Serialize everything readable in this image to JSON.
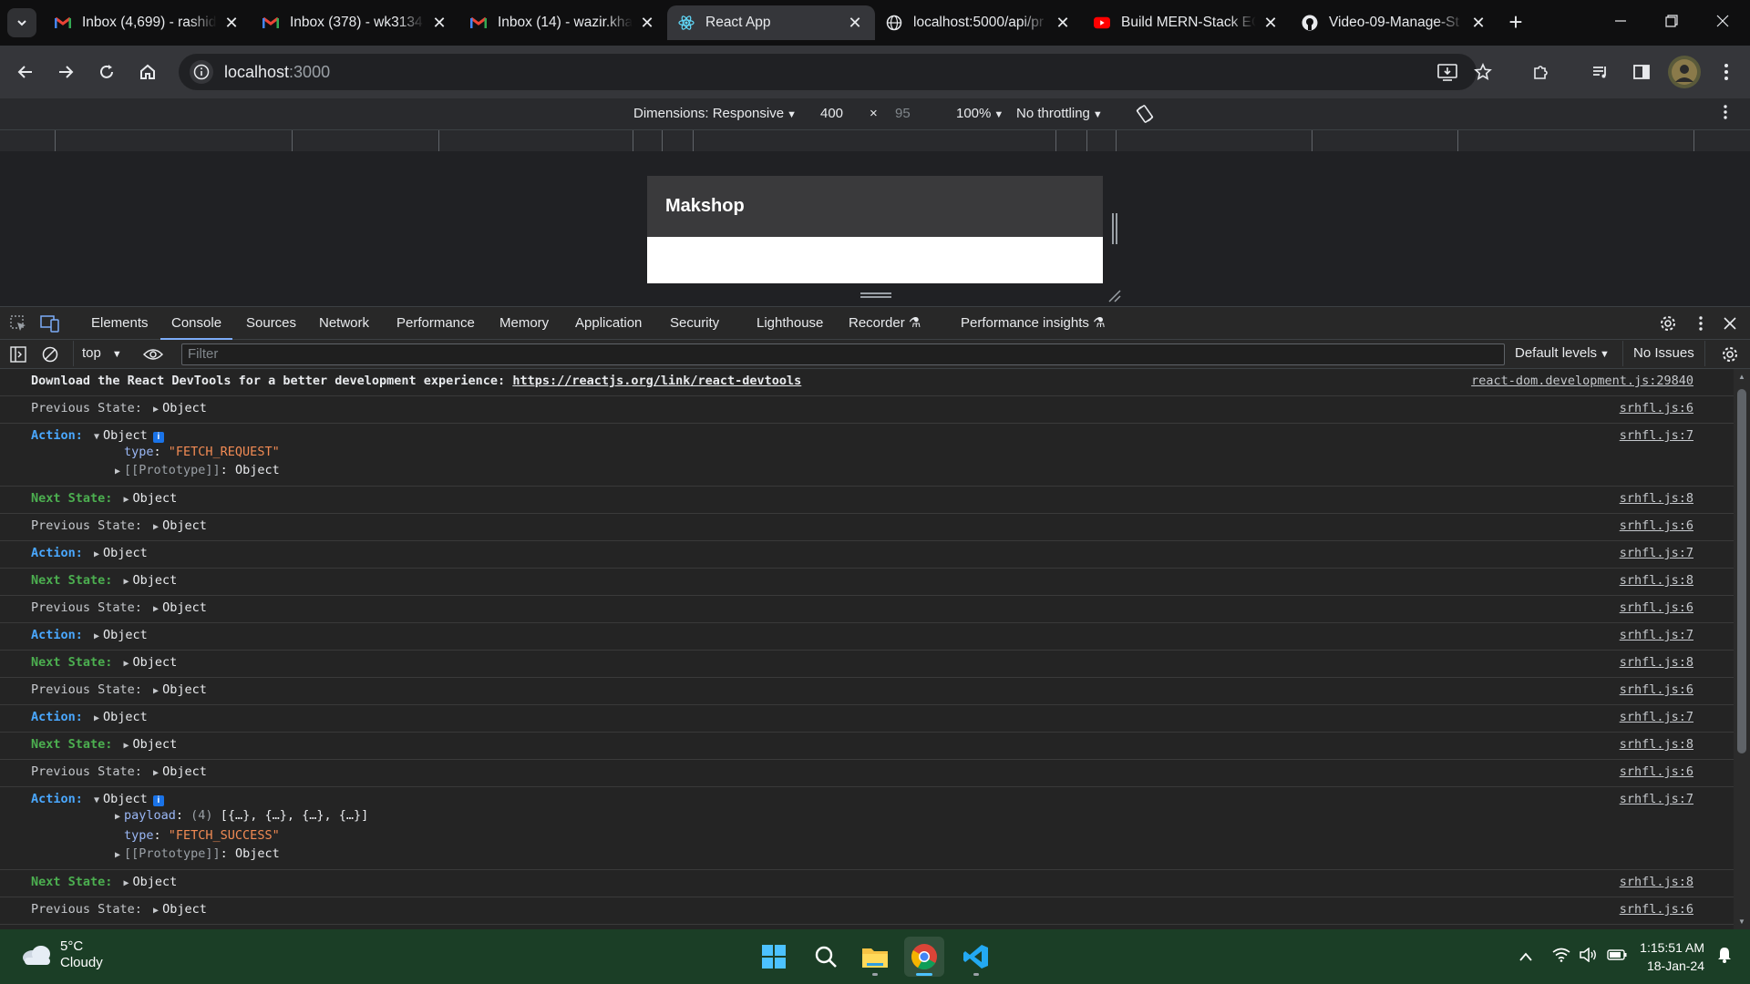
{
  "browser": {
    "tabs": [
      {
        "icon": "gmail-icon",
        "title": "Inbox (4,699) - rashid"
      },
      {
        "icon": "gmail-icon",
        "title": "Inbox (378) - wk3134"
      },
      {
        "icon": "gmail-icon",
        "title": "Inbox (14) - wazir.kha"
      },
      {
        "icon": "react-icon",
        "title": "React App",
        "active": true
      },
      {
        "icon": "globe-icon",
        "title": "localhost:5000/api/pr"
      },
      {
        "icon": "youtube-icon",
        "title": "Build MERN-Stack EC"
      },
      {
        "icon": "github-icon",
        "title": "Video-09-Manage-St"
      }
    ],
    "url_host": "localhost",
    "url_port": ":3000"
  },
  "device_toolbar": {
    "dimensions": "Dimensions: Responsive",
    "width": "400",
    "times": "×",
    "height": "95",
    "zoom": "100%",
    "throttling": "No throttling"
  },
  "app": {
    "brand": "Makshop"
  },
  "devtools": {
    "tabs": [
      "Elements",
      "Console",
      "Sources",
      "Network",
      "Performance",
      "Memory",
      "Application",
      "Security",
      "Lighthouse",
      "Recorder",
      "Performance insights"
    ],
    "active_tab": "Console",
    "context": "top",
    "filter_placeholder": "Filter",
    "levels": "Default levels",
    "issues": "No Issues"
  },
  "console": {
    "devtools_msg": "Download the React DevTools for a better development experience: ",
    "devtools_link": "https://reactjs.org/link/react-devtools",
    "devtools_src": "react-dom.development.js:29840",
    "labels": {
      "prev": "Previous State:",
      "action": "Action:",
      "next": "Next State:"
    },
    "object": "Object",
    "src": {
      "prev": "srhfl.js:6",
      "action": "srhfl.js:7",
      "next": "srhfl.js:8"
    },
    "fetch_request": {
      "type_key": "type",
      "type_val": "\"FETCH_REQUEST\"",
      "proto": "[[Prototype]]",
      "proto_val": "Object"
    },
    "fetch_success": {
      "payload_key": "payload",
      "payload_count": "(4)",
      "payload_val": "[{…}, {…}, {…}, {…}]",
      "type_key": "type",
      "type_val": "\"FETCH_SUCCESS\"",
      "proto": "[[Prototype]]",
      "proto_val": "Object"
    }
  },
  "taskbar": {
    "temp": "5°C",
    "condition": "Cloudy",
    "time": "1:15:51 AM",
    "date": "18-Jan-24"
  }
}
